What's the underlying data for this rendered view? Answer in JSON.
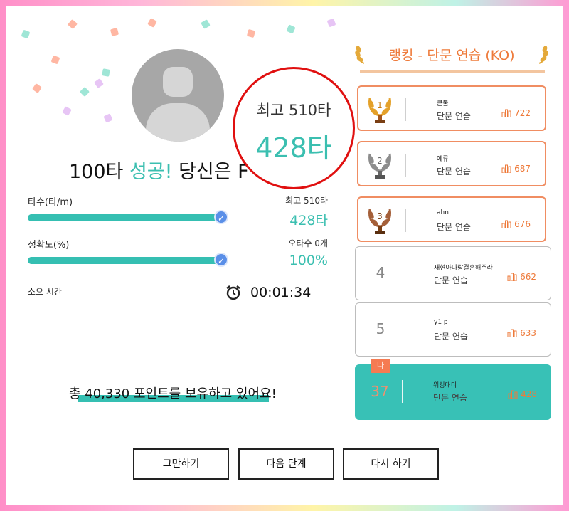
{
  "result": {
    "headline_prefix": "100타 ",
    "headline_success": "성공!",
    "headline_suffix": " 당신은 F",
    "best_label": "최고 510타",
    "current_label": "428타"
  },
  "stats": {
    "speed": {
      "label": "타수(타/m)",
      "best": "최고 510타",
      "value": "428타",
      "progress": 1.0
    },
    "accuracy": {
      "label": "정확도(%)",
      "errors": "오타수 0개",
      "value": "100%",
      "progress": 1.0
    },
    "time": {
      "label": "소요 시간",
      "value": "00:01:34"
    }
  },
  "points_text": "총 40,330 포인트를 보유하고 있어요!",
  "buttons": {
    "quit": "그만하기",
    "next": "다음 단계",
    "retry": "다시 하기"
  },
  "ranking": {
    "title": "랭킹 - 단문 연습 (KO)",
    "entries": [
      {
        "rank": "1",
        "name": "큰불",
        "mode": "단문 연습",
        "score": "722",
        "medal": "gold"
      },
      {
        "rank": "2",
        "name": "예류",
        "mode": "단문 연습",
        "score": "687",
        "medal": "silver"
      },
      {
        "rank": "3",
        "name": "ahn",
        "mode": "단문 연습",
        "score": "676",
        "medal": "bronze"
      },
      {
        "rank": "4",
        "name": "재현아나랑결혼해주라",
        "mode": "단문 연습",
        "score": "662"
      },
      {
        "rank": "5",
        "name": "y1 p",
        "mode": "단문 연습",
        "score": "633"
      }
    ],
    "me": {
      "tag": "나",
      "rank": "37",
      "name": "워킹대디",
      "mode": "단문 연습",
      "score": "428"
    }
  },
  "colors": {
    "accent": "#3bbfb0",
    "orange": "#ee7a3a",
    "highlight": "#e01010"
  },
  "icons": {
    "check": "check-circle-icon",
    "alarm": "alarm-clock-icon",
    "score": "bar-chart-icon",
    "trophy": "laurel-trophy-icon"
  }
}
